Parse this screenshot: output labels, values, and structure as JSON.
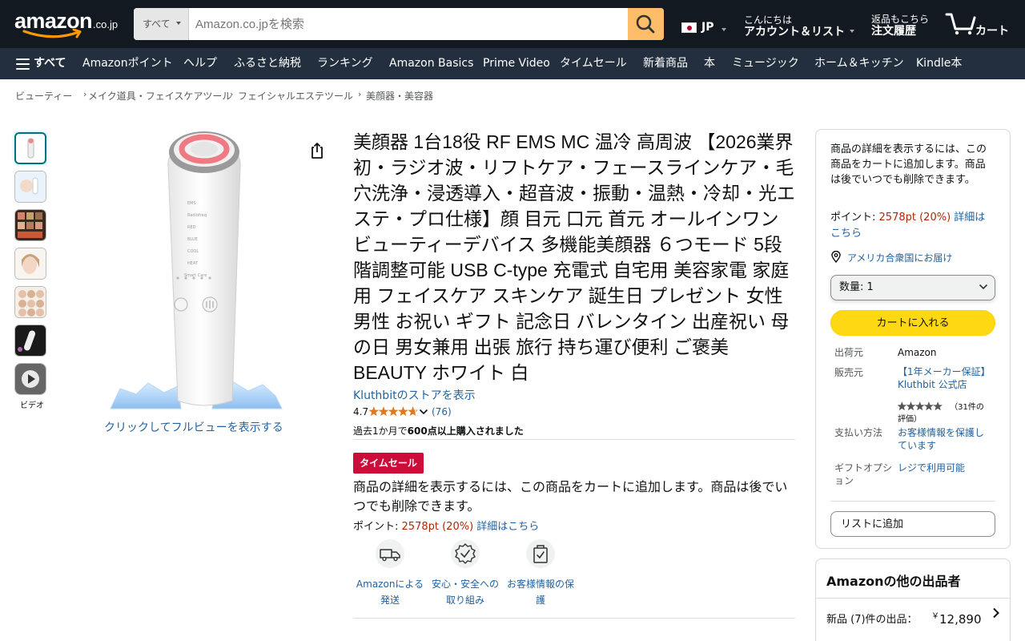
{
  "header": {
    "logo_text": "amazon",
    "logo_suffix": ".co.jp",
    "search": {
      "department": "すべて",
      "placeholder": "Amazon.co.jpを検索"
    },
    "locale": "JP",
    "account": {
      "greeting": "こんにちは",
      "label": "アカウント＆リスト"
    },
    "orders": {
      "line1": "返品もこちら",
      "line2": "注文履歴"
    },
    "cart_label": "カート"
  },
  "nav": {
    "all_label": "すべて",
    "items": [
      "Amazonポイント",
      "ヘルプ",
      "ふるさと納税",
      "ランキング",
      "Amazon Basics",
      "Prime Video",
      "タイムセール",
      "新着商品",
      "本",
      "ミュージック",
      "ホーム＆キッチン",
      "Kindle本"
    ]
  },
  "breadcrumb": [
    "ビューティー",
    "メイク道具・フェイスケアツール",
    "フェイシャルエステツール",
    "美顔器・美容器"
  ],
  "gallery": {
    "video_label": "ビデオ",
    "fullview_label": "クリックしてフルビューを表示する"
  },
  "product": {
    "title": "美顔器 1台18役 RF EMS MC 温冷 高周波 【2026業界初・ラジオ波・リフトケア・フェースラインケア・毛穴洗浄・浸透導入・超音波・振動・温熱・冷却・光エステ・プロ仕様】顔 目元 口元 首元 オールインワン ビューティーデバイス 多機能美顔器 ６つモード 5段階調整可能 USB C-type 充電式 自宅用 美容家電 家庭用 フェイスケア スキンケア 誕生日 プレゼント 女性 男性 お祝い ギフト 記念日 バレンタイン 出産祝い 母の日 男女兼用 出張 旅行 持ち運び便利 ご褒美 BEAUTY ホワイト 白",
    "store_link": "Kluthbitのストアを表示",
    "rating": "4.7",
    "rating_stars": 4.7,
    "rating_count": "(76)",
    "bought_prefix": "過去1か月で",
    "bought_bold": "600点以上購入されました",
    "deal_badge": "タイムセール",
    "price_note": "商品の詳細を表示するには、この商品をカートに追加します。商品は後でいつでも削除できます。",
    "points_label": "ポイント:",
    "points_value": "2578pt",
    "points_pct": "(20%)",
    "points_link": "詳細はこちら",
    "features": [
      {
        "icon": "truck-icon",
        "label": "Amazonによる発送"
      },
      {
        "icon": "shield-check-icon",
        "label": "安心・安全への取り組み"
      },
      {
        "icon": "secure-bag-icon",
        "label": "お客様情報の保護"
      }
    ]
  },
  "buybox": {
    "note": "商品の詳細を表示するには、この商品をカートに追加します。商品は後でいつでも削除できます。",
    "points_label": "ポイント:",
    "points_value": "2578pt",
    "points_pct": "(20%)",
    "points_link": "詳細はこちら",
    "delivery": "アメリカ合衆国にお届け",
    "quantity_label": "数量:",
    "quantity_value": "1",
    "add_to_cart": "カートに入れる",
    "shipper_key": "出荷元",
    "shipper_val": "Amazon",
    "seller_key": "販売元",
    "seller_val": "【1年メーカー保証】Kluthbit 公式店",
    "seller_reviews": "（31件の評価）",
    "seller_stars": 5,
    "payment_key": "支払い方法",
    "payment_val": "お客様情報を保護しています",
    "gift_key": "ギフトオプション",
    "gift_val": "レジで利用可能",
    "add_to_list": "リストに追加"
  },
  "other_sellers": {
    "title": "Amazonの他の出品者",
    "row_label": "新品 (7)件の出品：",
    "currency": "￥",
    "price": "12,890"
  },
  "colors": {
    "header_bg": "#131921",
    "subnav_bg": "#232f3e",
    "search_button": "#febd69",
    "link": "#2162a1",
    "deal_red": "#cc0c39",
    "points_red": "#b12704",
    "cart_yellow": "#ffd814",
    "star_orange": "#de7921"
  }
}
